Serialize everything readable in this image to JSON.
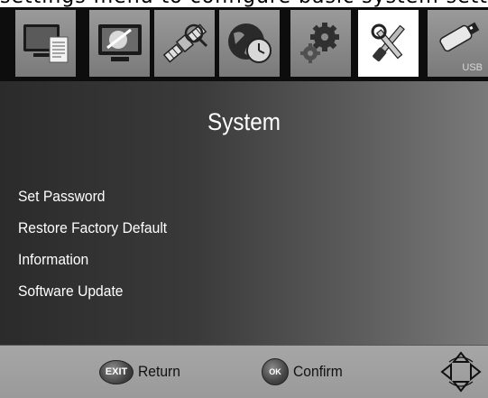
{
  "top_strip_text": "settings menu to configure basic system settings. The option",
  "menu_bar": {
    "tiles": [
      {
        "name": "program-manage",
        "icon": "tv-document-icon",
        "active": false
      },
      {
        "name": "picture",
        "icon": "monitor-brush-icon",
        "active": false
      },
      {
        "name": "channel-search",
        "icon": "satellite-icon",
        "active": false
      },
      {
        "name": "time",
        "icon": "globe-clock-icon",
        "active": false
      },
      {
        "name": "option",
        "icon": "gears-icon",
        "active": false
      },
      {
        "name": "system",
        "icon": "tools-icon",
        "active": true
      },
      {
        "name": "usb",
        "icon": "usb-drive-icon",
        "active": false,
        "label": "USB"
      }
    ]
  },
  "page": {
    "title": "System"
  },
  "menu": {
    "items": [
      {
        "label": "Set Password"
      },
      {
        "label": "Restore Factory Default"
      },
      {
        "label": "Information"
      },
      {
        "label": "Software Update"
      }
    ]
  },
  "help": {
    "exit_key": "EXIT",
    "exit_label": "Return",
    "ok_key": "OK",
    "ok_label": "Confirm",
    "nav_icon": "dpad-icon"
  },
  "colors": {
    "active_tile": "#ffffff",
    "tile": "#8a8a8a",
    "text": "#ffffff",
    "bar": "#a0a0a0"
  }
}
